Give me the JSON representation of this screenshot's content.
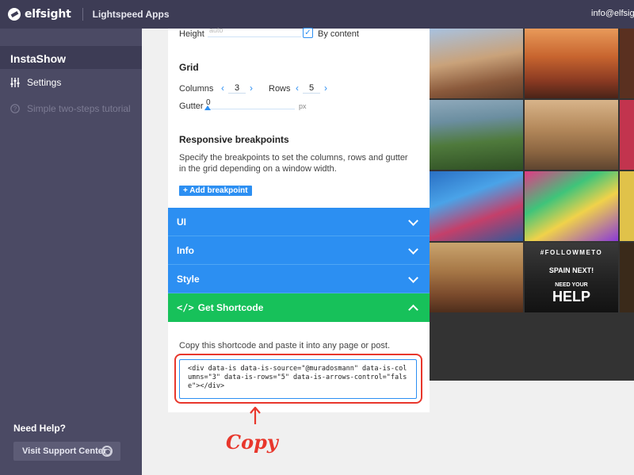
{
  "topbar": {
    "brand": "elfsight",
    "apps_label": "Lightspeed Apps",
    "account": "info@elfsight"
  },
  "sidebar": {
    "app_title": "InstaShow",
    "items": [
      {
        "label": "Settings",
        "icon": "sliders-icon"
      },
      {
        "label": "Simple two-steps tutorial",
        "icon": "question-icon"
      }
    ],
    "help_title": "Need Help?",
    "support_button": "Visit Support Center"
  },
  "editor": {
    "height_label": "Height",
    "height_value": "auto",
    "by_content_label": "By content",
    "by_content_checked": true,
    "grid_heading": "Grid",
    "columns_label": "Columns",
    "columns_value": "3",
    "rows_label": "Rows",
    "rows_value": "5",
    "gutter_label": "Gutter",
    "gutter_value": "0",
    "gutter_unit": "px",
    "breakpoints_heading": "Responsive breakpoints",
    "breakpoints_desc": "Specify the breakpoints to set the columns, rows and gutter in the grid depending on a window width.",
    "add_breakpoint": "+ Add breakpoint",
    "sections": [
      {
        "label": "UI"
      },
      {
        "label": "Info"
      },
      {
        "label": "Style"
      }
    ],
    "shortcode_section": "Get Shortcode",
    "shortcode_hint": "Copy this shortcode and paste it into any page or post.",
    "shortcode": "<div data-is data-is-source=\"@muradosmann\" data-is-columns=\"3\" data-is-rows=\"5\" data-is-arrows-control=\"false\"></div>"
  },
  "annotation": {
    "label": "Copy",
    "color": "#e8372c"
  },
  "preview": {
    "captions": {
      "follow": "#FOLLOWMETO",
      "spain": "SPAIN NEXT!",
      "need": "NEED YOUR",
      "help": "HELP"
    }
  },
  "colors": {
    "accent_blue": "#2c8ff2",
    "accent_green": "#17c15a",
    "sidebar": "#4b4a64",
    "topbar": "#3d3c55"
  }
}
